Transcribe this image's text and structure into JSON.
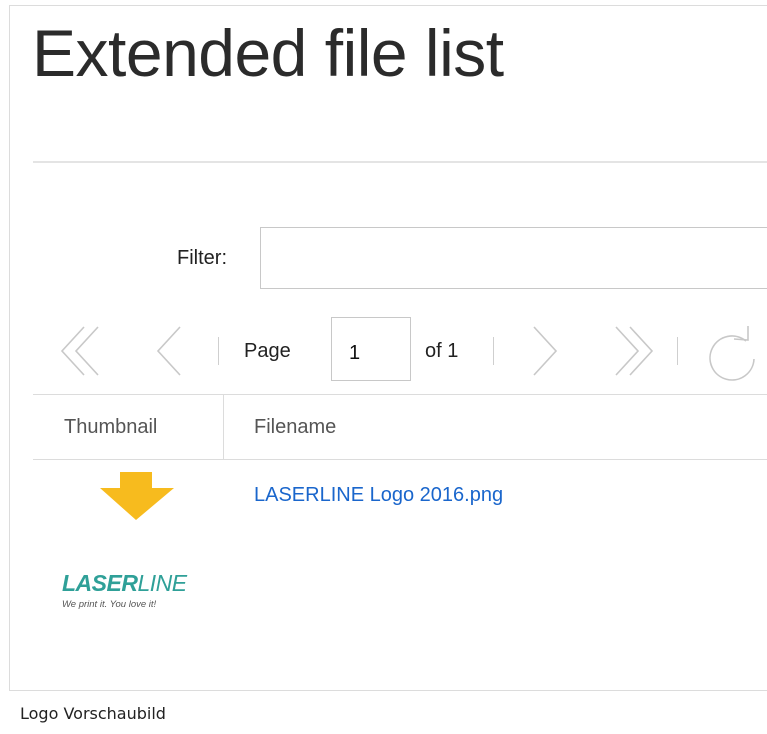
{
  "page": {
    "title": "Extended file list"
  },
  "filter": {
    "label": "Filter:",
    "value": "",
    "placeholder": ""
  },
  "pager": {
    "page_label": "Page",
    "current_page": "1",
    "of_label": "of 1",
    "icons": [
      "double-chevron-left-icon",
      "chevron-left-icon",
      "chevron-right-icon",
      "double-chevron-right-icon",
      "refresh-icon"
    ]
  },
  "table": {
    "columns": [
      "Thumbnail",
      "Filename"
    ],
    "rows": [
      {
        "filename": "LASERLINE Logo 2016.png",
        "thumbnail_alt": "LASERLINE"
      }
    ]
  },
  "logo": {
    "brand_bold": "LASER",
    "brand_thin": "LINE",
    "tagline": "We print it. You love it!"
  },
  "annotation": {
    "arrow_color": "#f7bb1e",
    "icon": "arrow-down-icon"
  },
  "caption": "Logo Vorschaubild",
  "colors": {
    "link": "#1a66cc",
    "brand": "#2fa098",
    "pager_icon": "#c8c8c8"
  }
}
